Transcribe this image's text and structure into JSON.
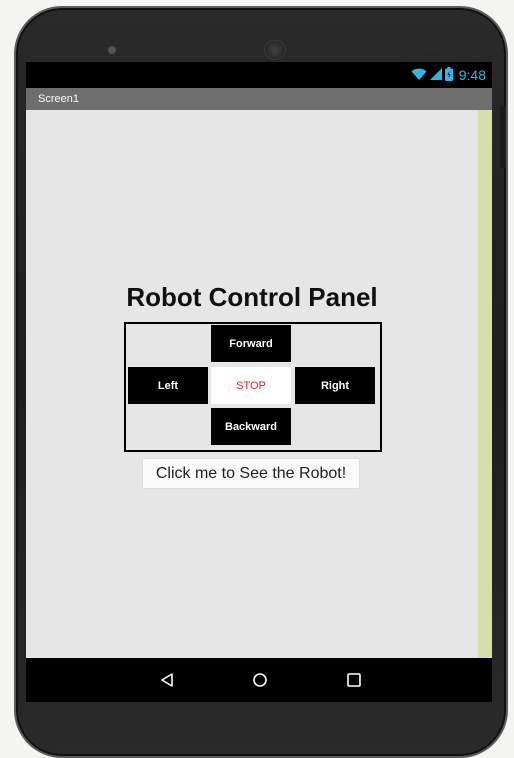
{
  "status_bar": {
    "time": "9:48",
    "icons": [
      "wifi-icon",
      "signal-icon",
      "battery-icon"
    ],
    "accent_color": "#33b5e5"
  },
  "title_bar": {
    "title": "Screen1"
  },
  "main": {
    "heading": "Robot Control Panel",
    "controls": {
      "forward": "Forward",
      "left": "Left",
      "stop": "STOP",
      "right": "Right",
      "backward": "Backward"
    },
    "robot_button": "Click me to See the Robot!"
  },
  "nav_bar": {
    "icons": [
      "back-icon",
      "home-icon",
      "recents-icon"
    ]
  },
  "colors": {
    "screen_background": "#e6e6e6",
    "control_button": "#000000",
    "stop_text": "#e02020",
    "side_strip": "#d6e0a6"
  }
}
